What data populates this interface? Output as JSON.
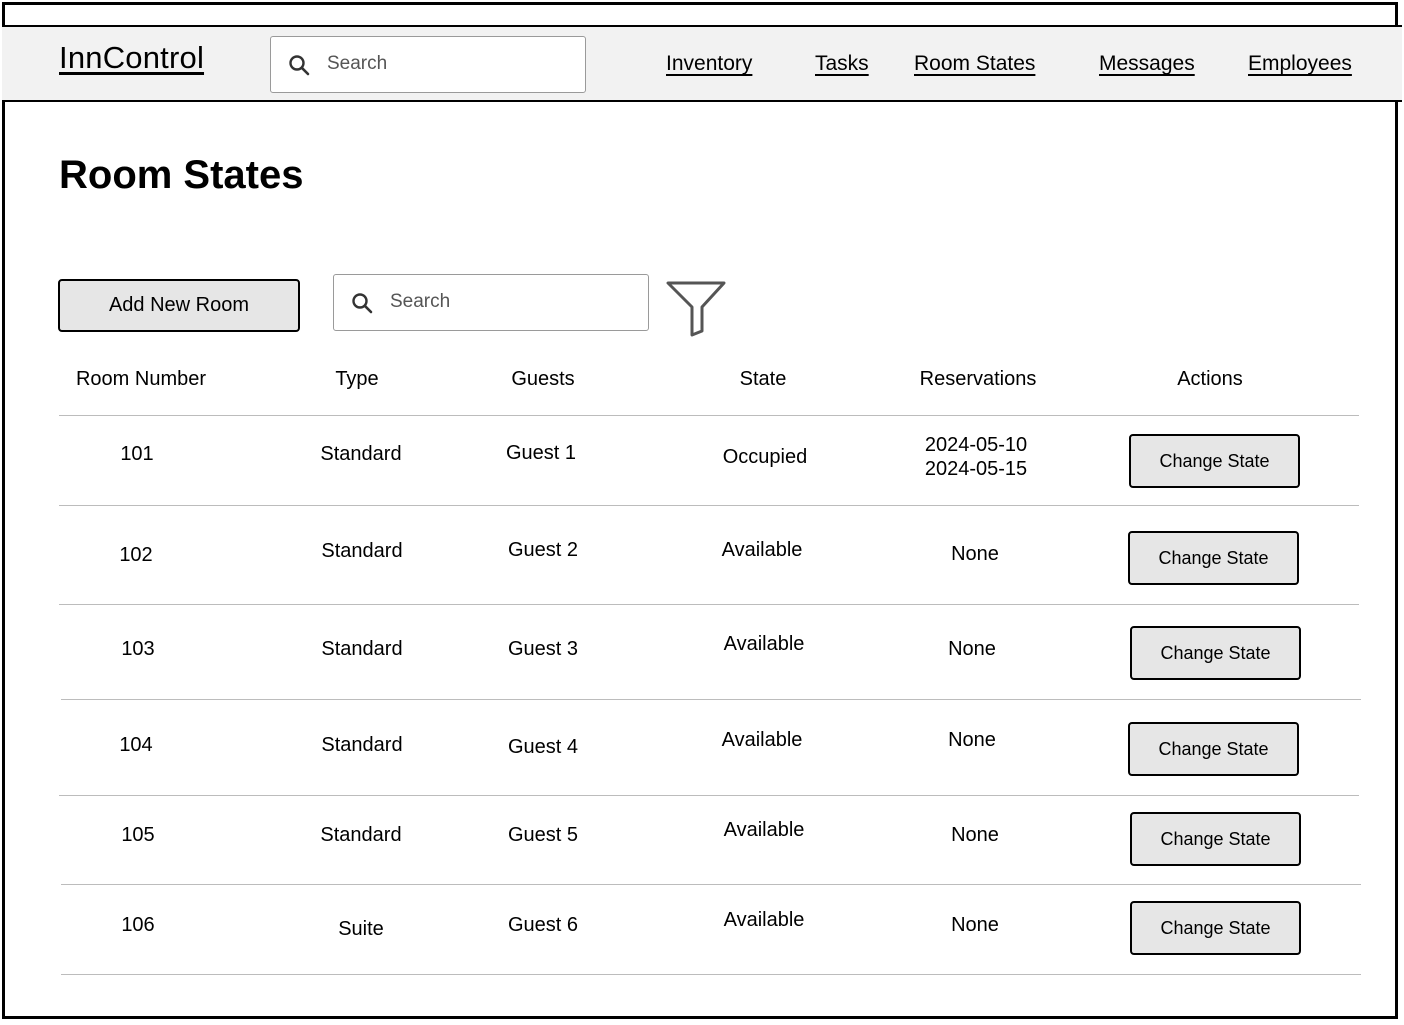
{
  "app": {
    "name": "InnControl"
  },
  "header": {
    "search_placeholder": "Search",
    "nav": [
      "Inventory",
      "Tasks",
      "Room States",
      "Messages",
      "Employees"
    ]
  },
  "page": {
    "title": "Room States",
    "add_button": "Add New Room",
    "search_placeholder": "Search",
    "filter_icon": "filter-icon"
  },
  "table": {
    "headers": [
      "Room Number",
      "Type",
      "Guests",
      "State",
      "Reservations",
      "Actions"
    ],
    "rows": [
      {
        "room": "101",
        "type": "Standard",
        "guest": "Guest 1",
        "state": "Occupied",
        "res1": "2024-05-10",
        "res2": "2024-05-15",
        "action": "Change State"
      },
      {
        "room": "102",
        "type": "Standard",
        "guest": "Guest 2",
        "state": "Available",
        "res1": "None",
        "res2": "",
        "action": "Change State"
      },
      {
        "room": "103",
        "type": "Standard",
        "guest": "Guest 3",
        "state": "Available",
        "res1": "None",
        "res2": "",
        "action": "Change State"
      },
      {
        "room": "104",
        "type": "Standard",
        "guest": "Guest 4",
        "state": "Available",
        "res1": "None",
        "res2": "",
        "action": "Change State"
      },
      {
        "room": "105",
        "type": "Standard",
        "guest": "Guest 5",
        "state": "Available",
        "res1": "None",
        "res2": "",
        "action": "Change State"
      },
      {
        "room": "106",
        "type": "Suite",
        "guest": "Guest 6",
        "state": "Available",
        "res1": "None",
        "res2": "",
        "action": "Change State"
      }
    ]
  }
}
